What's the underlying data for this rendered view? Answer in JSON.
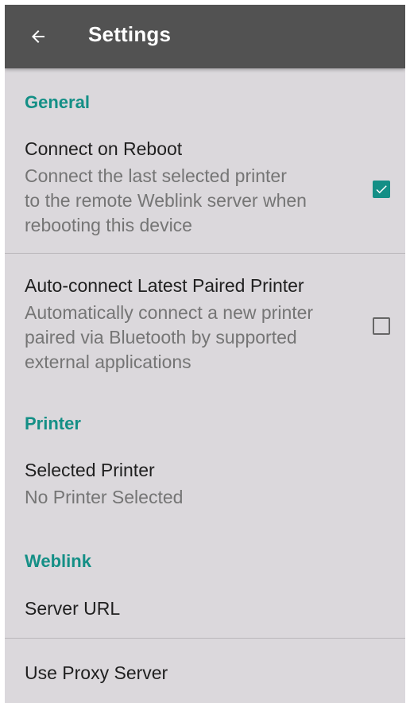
{
  "app_bar": {
    "title": "Settings",
    "back_icon": "arrow-left-icon"
  },
  "general": {
    "header": "General",
    "connect_on_reboot": {
      "title": "Connect on Reboot",
      "summary": "Connect the last selected printer\nto the remote Weblink server when\nrebooting this device",
      "checked": true
    },
    "auto_connect": {
      "title": "Auto-connect Latest Paired Printer",
      "summary": "Automatically connect a new printer\npaired via Bluetooth by supported\nexternal applications",
      "checked": false
    }
  },
  "printer": {
    "header": "Printer",
    "selected_printer": {
      "title": "Selected Printer",
      "summary": "No Printer Selected"
    }
  },
  "weblink": {
    "header": "Weblink",
    "server_url": {
      "title": "Server URL"
    },
    "use_proxy": {
      "title": "Use Proxy Server"
    }
  },
  "colors": {
    "accent": "#148f86",
    "app_bar": "#525252",
    "background": "#dbd8dc"
  }
}
